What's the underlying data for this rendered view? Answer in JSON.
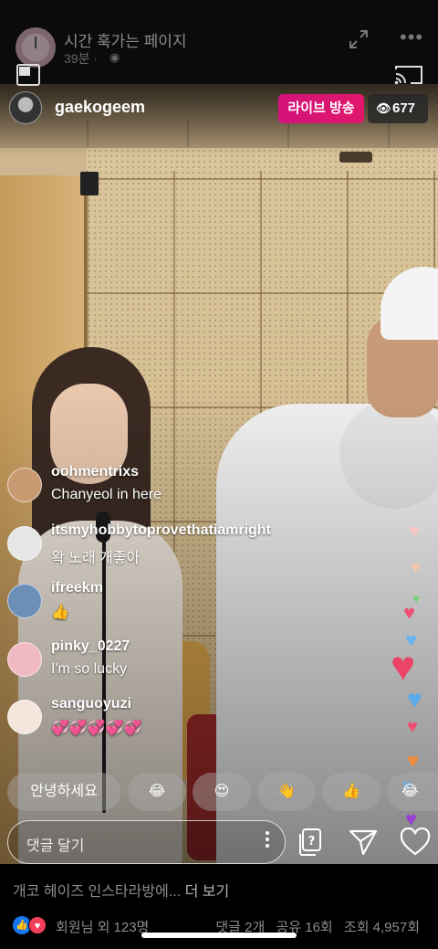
{
  "facebook_post": {
    "page_name": "시간 훅가는 페이지",
    "post_time": "39분 ·",
    "globe_glyph": "◉",
    "description": "개코 헤이즈 인스타라방에... ",
    "see_more": "더 보기",
    "reactions": {
      "friends_text": "회원님 외 123명",
      "comments": "댓글 2개",
      "shares": "공유 16회",
      "views": "조회 4,957회"
    }
  },
  "live": {
    "username": "gaekogeem",
    "live_badge": "라이브 방송",
    "viewer_count": "677",
    "eye_glyph": "👁"
  },
  "comments": [
    {
      "user": "oohmentrixs",
      "text": "Chanyeol in here",
      "avatar_color": "#c99a72"
    },
    {
      "user": "itsmyhobbytoprovethatiamright",
      "text": "왁 노래 개좋아",
      "avatar_color": "#e6e6e6"
    },
    {
      "user": "ifreekm",
      "text": "👍",
      "avatar_color": "#6c8fb8"
    },
    {
      "user": "pinky_0227",
      "text": "I'm so lucky",
      "avatar_color": "#f1b9c2"
    },
    {
      "user": "sanguoyuzi",
      "text": "💞💞💞💞💞",
      "avatar_color": "#f4e6dc"
    }
  ],
  "quick_replies": [
    {
      "label": "안녕하세요"
    },
    {
      "label": "😂"
    },
    {
      "label": "😍"
    },
    {
      "label": "👋"
    },
    {
      "label": "👍"
    },
    {
      "label": "😂"
    }
  ],
  "comment_bar": {
    "placeholder": "댓글 달기"
  },
  "icons": {
    "expand": "expand-icon",
    "more": "more-icon",
    "pip": "picture-in-picture-icon",
    "cast": "cast-icon",
    "qa": "question-icon",
    "send": "send-icon",
    "like": "heart-icon"
  },
  "colors": {
    "live_badge": "#d3127a",
    "heart": "#e8456e",
    "fb_like": "#1877f2",
    "fb_love": "#f33e58"
  }
}
